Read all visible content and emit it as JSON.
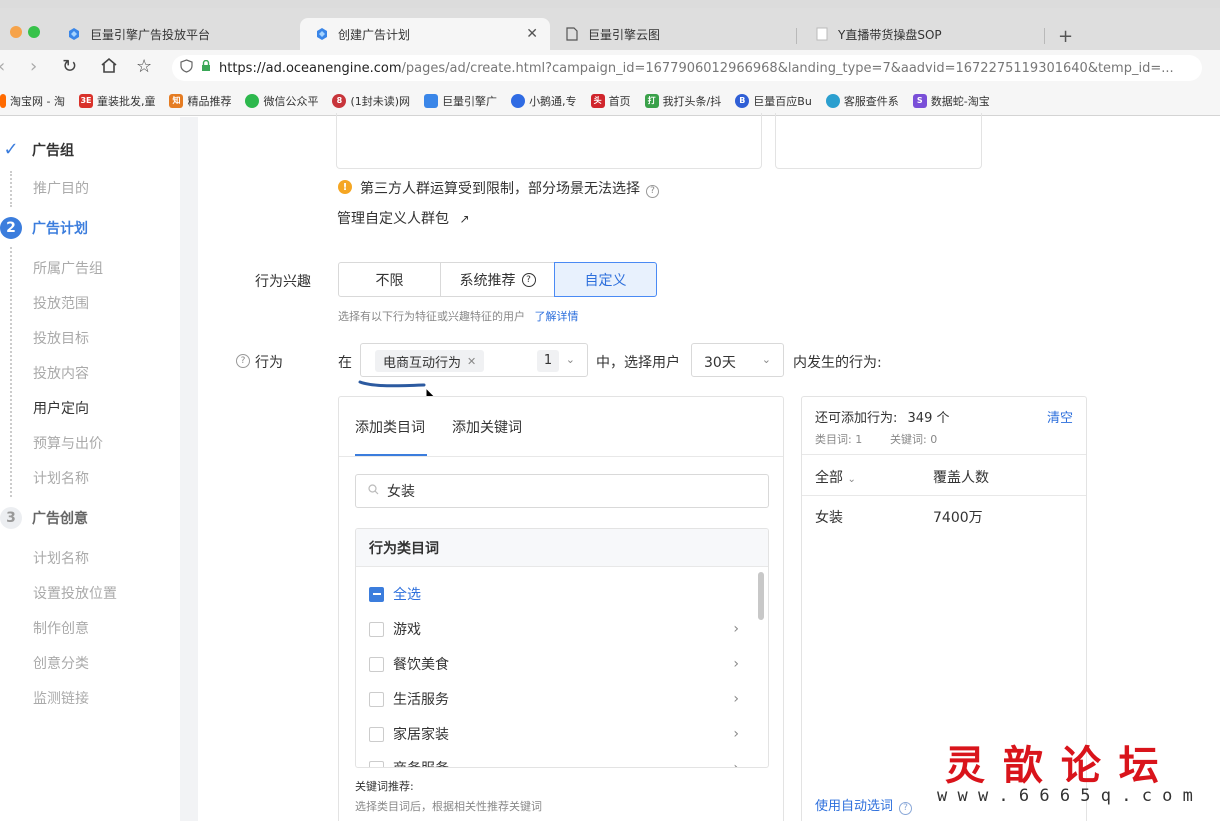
{
  "browser": {
    "tabs": [
      {
        "label": "巨量引擎广告投放平台",
        "active": false
      },
      {
        "label": "创建广告计划",
        "active": true
      },
      {
        "label": "巨量引擎云图",
        "active": false
      },
      {
        "label": "Y直播带货操盘SOP",
        "active": false
      }
    ],
    "url_host": "https://ad.oceanengine.com",
    "url_rest": "/pages/ad/create.html?campaign_id=1677906012966968&landing_type=7&aadvid=1672275119301640&temp_id=...",
    "bookmarks": [
      "淘宝网 - 淘",
      "童装批发,童",
      "精品推荐",
      "微信公众平",
      "(1封未读)网",
      "巨量引擎广",
      "小鹅通,专",
      "首页",
      "我打头条/抖",
      "巨量百应Bu",
      "客服查件系",
      "数据蛇-淘宝"
    ]
  },
  "sidebar": {
    "groups": [
      {
        "num": "✓",
        "title": "广告组",
        "items": [
          "推广目的"
        ]
      },
      {
        "num": "2",
        "title": "广告计划",
        "items": [
          "所属广告组",
          "投放范围",
          "投放目标",
          "投放内容",
          "用户定向",
          "预算与出价",
          "计划名称"
        ]
      },
      {
        "num": "3",
        "title": "广告创意",
        "items": [
          "计划名称",
          "设置投放位置",
          "制作创意",
          "创意分类",
          "监测链接"
        ]
      }
    ]
  },
  "main": {
    "warning_text": "第三方人群运算受到限制，部分场景无法选择",
    "manage_link": "管理自定义人群包",
    "interest_label": "行为兴趣",
    "interest_options": [
      "不限",
      "系统推荐",
      "自定义"
    ],
    "interest_selected": "自定义",
    "interest_hint": "选择有以下行为特征或兴趣特征的用户",
    "interest_hint_link": "了解详情",
    "behavior_label": "行为",
    "behavior_prefix": "在",
    "behavior_tag": "电商互动行为",
    "behavior_count": "1",
    "behavior_mid": "中，选择用户",
    "behavior_days": "30天",
    "behavior_suffix": "内发生的行为:",
    "left_panel": {
      "tabs": [
        "添加类目词",
        "添加关键词"
      ],
      "search_value": "女装",
      "category_header": "行为类目词",
      "select_all": "全选",
      "categories": [
        "游戏",
        "餐饮美食",
        "生活服务",
        "家居家装",
        "商务服务"
      ],
      "keyword_title": "关键词推荐:",
      "keyword_hint": "选择类目词后，根据相关性推荐关键词"
    },
    "right_panel": {
      "remaining_label": "还可添加行为:",
      "remaining_count": "349 个",
      "clear": "清空",
      "cat_count": "类目词: 1",
      "kw_count": "关键词: 0",
      "col_all": "全部",
      "col_reach": "覆盖人数",
      "rows": [
        {
          "name": "女装",
          "reach": "7400万"
        }
      ],
      "auto_select": "使用自动选词"
    }
  },
  "watermark": {
    "title": "灵 歆 论 坛",
    "url": "w w w . 6 6 6 5 q . c o m"
  }
}
